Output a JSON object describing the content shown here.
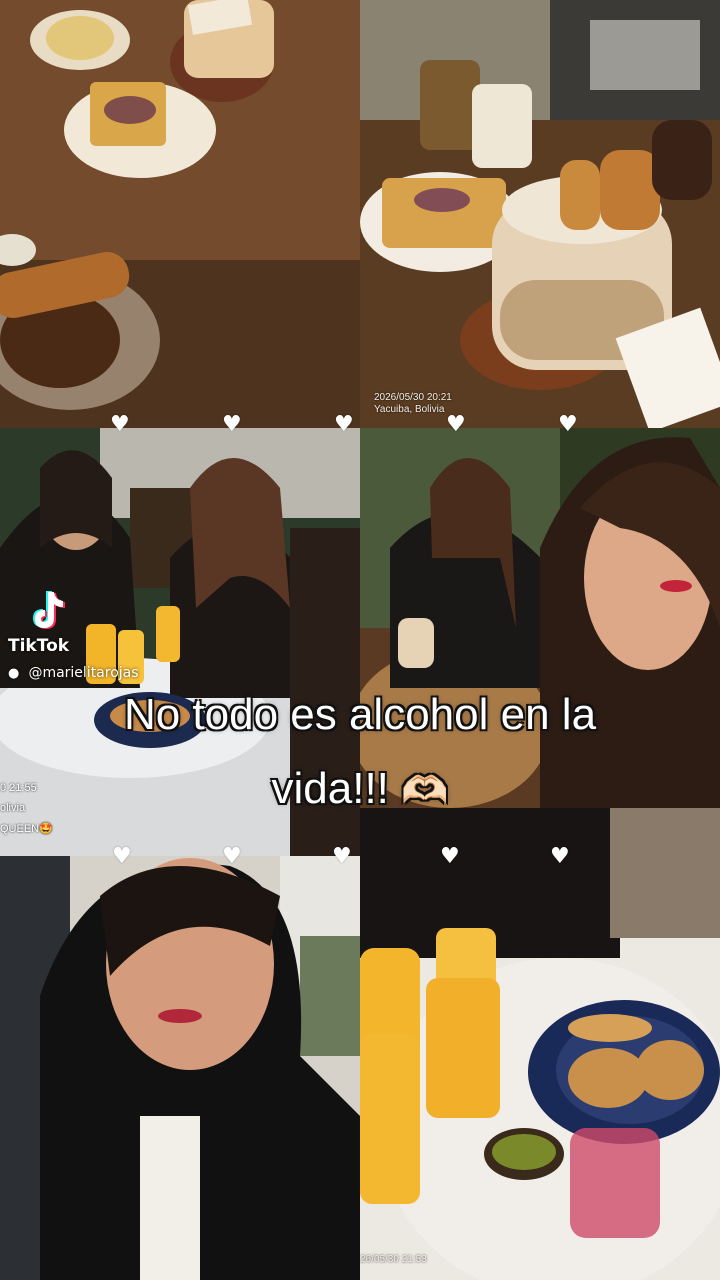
{
  "caption": {
    "line1": "No todo es alcohol en la",
    "line2": "vida!!!",
    "emoji": "🫶🏻"
  },
  "watermark": {
    "brand": "TikTok",
    "username": "@marielitarojas",
    "side_time": "0 21:55",
    "side_place": "olivia",
    "side_text": "QUEEN🤩"
  },
  "stamps": {
    "top_right_time": "2026/05/30 20:21",
    "top_right_place": "Yacuiba, Bolivia",
    "bottom_right_time": "26/05/30 21:53"
  },
  "heart_glyph": "♥",
  "colors": {
    "caption_text": "#ffffff",
    "caption_outline": "#111111",
    "tiktok_cyan": "#25F4EE",
    "tiktok_red": "#FE2C55"
  }
}
